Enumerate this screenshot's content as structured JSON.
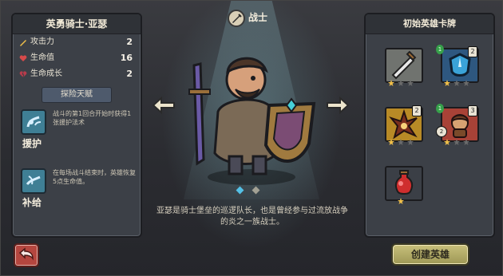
{
  "left_panel": {
    "hero_name": "英勇骑士·亚瑟",
    "stats": [
      {
        "label": "攻击力",
        "value": "2"
      },
      {
        "label": "生命值",
        "value": "16"
      },
      {
        "label": "生命成长",
        "value": "2"
      }
    ],
    "talent_header": "探险天赋",
    "talents": [
      {
        "name": "援护",
        "desc": "战斗的第1回合开始时获得1张援护法术"
      },
      {
        "name": "补给",
        "desc": "在每场战斗结束时，英雄恢复5点生命值。"
      }
    ]
  },
  "center": {
    "class_label": "战士",
    "description": "亚瑟是骑士堡垒的巡逻队长，也是曾经参与过流放战争的炎之一族战士。"
  },
  "right_panel": {
    "title": "初始英雄卡牌",
    "cards": [
      {
        "name": "sword-card",
        "cost": "",
        "gem": "",
        "lvl": ""
      },
      {
        "name": "shield-card",
        "cost": "2",
        "gem": "1",
        "lvl": ""
      },
      {
        "name": "burst-card",
        "cost": "2",
        "gem": "",
        "lvl": ""
      },
      {
        "name": "companion-card",
        "cost": "3",
        "gem": "1",
        "lvl": "2"
      },
      {
        "name": "potion-card",
        "cost": "",
        "gem": "",
        "lvl": ""
      }
    ]
  },
  "buttons": {
    "create_label": "创建英雄"
  }
}
